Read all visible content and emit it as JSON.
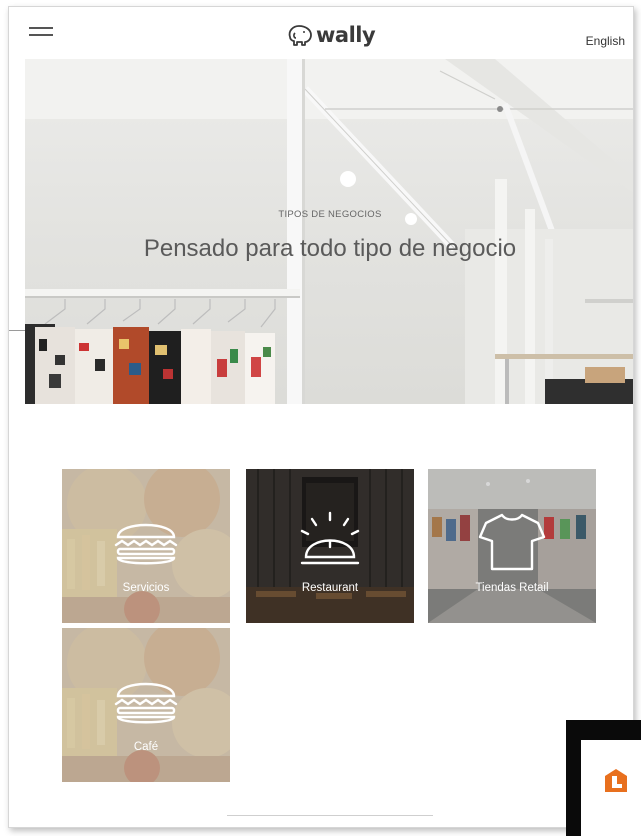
{
  "header": {
    "logo_text": "wally",
    "language_label": "English"
  },
  "hero": {
    "eyebrow": "TIPOS DE NEGOCIOS",
    "title": "Pensado para todo tipo de negocio"
  },
  "categories": [
    {
      "label": "Servicios",
      "icon": "burger-icon"
    },
    {
      "label": "Restaurant",
      "icon": "cloche-icon"
    },
    {
      "label": "Tiendas Retail",
      "icon": "tshirt-icon"
    },
    {
      "label": "Café",
      "icon": "burger-icon"
    }
  ],
  "colors": {
    "app_icon_orange": "#e8701e",
    "tile_text": "#ffffff"
  }
}
